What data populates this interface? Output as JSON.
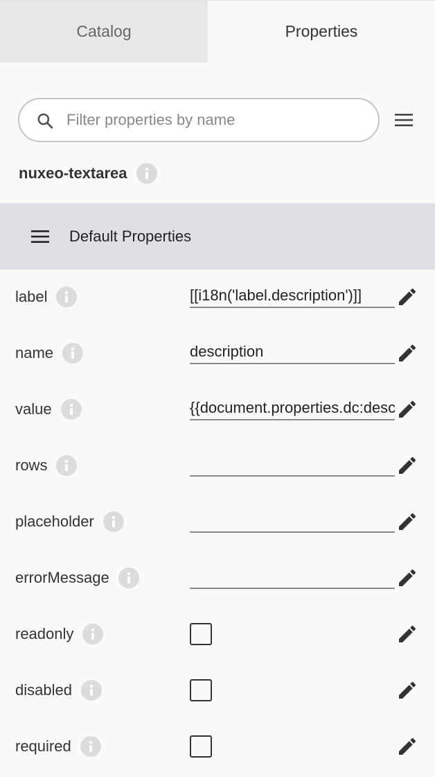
{
  "tabs": [
    {
      "label": "Catalog",
      "active": false
    },
    {
      "label": "Properties",
      "active": true
    }
  ],
  "filter": {
    "placeholder": "Filter properties by name",
    "value": ""
  },
  "component": {
    "name": "nuxeo-textarea"
  },
  "section": {
    "title": "Default Properties"
  },
  "properties": [
    {
      "label": "label",
      "type": "text",
      "value": "[[i18n('label.description')]]"
    },
    {
      "label": "name",
      "type": "text",
      "value": "description"
    },
    {
      "label": "value",
      "type": "text",
      "value": "{{document.properties.dc:description}}"
    },
    {
      "label": "rows",
      "type": "text",
      "value": ""
    },
    {
      "label": "placeholder",
      "type": "text",
      "value": ""
    },
    {
      "label": "errorMessage",
      "type": "text",
      "value": ""
    },
    {
      "label": "readonly",
      "type": "checkbox",
      "checked": false
    },
    {
      "label": "disabled",
      "type": "checkbox",
      "checked": false
    },
    {
      "label": "required",
      "type": "checkbox",
      "checked": false
    }
  ],
  "icons": {
    "search": "search-icon",
    "menu": "menu-icon",
    "info": "info-icon",
    "edit": "pencil-edit-icon"
  },
  "colors": {
    "section_bg": "#dfdfe6",
    "inactive_tab_bg": "#e8e8e8",
    "icon_gray": "#dcdcdc"
  }
}
